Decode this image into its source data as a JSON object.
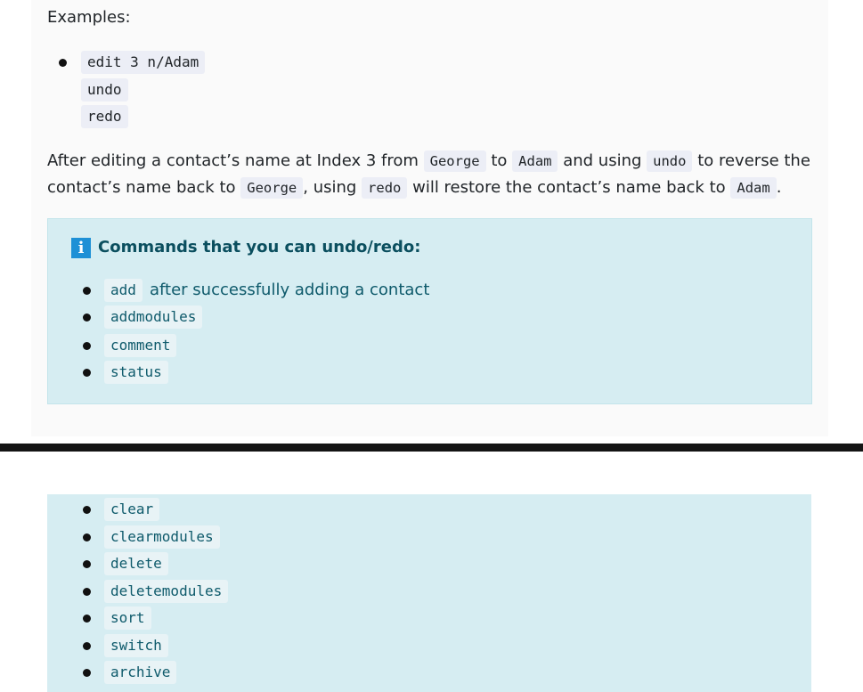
{
  "examples": {
    "title": "Examples:",
    "commands": [
      "edit 3 n/Adam",
      "undo",
      "redo"
    ]
  },
  "explanation": {
    "p1": "After editing a contact’s name at Index 3 from ",
    "c1": "George",
    "p2": " to ",
    "c2": "Adam",
    "p3": " and using ",
    "c3": "undo",
    "p4": " to reverse the contact’s name back to ",
    "c4": "George",
    "p5": ", using ",
    "c5": "redo",
    "p6": " will restore the contact’s name back to ",
    "c6": "Adam",
    "p7": "."
  },
  "info_box": {
    "icon": "info-icon",
    "heading": "Commands that you can undo/redo:",
    "items": [
      {
        "code": "add",
        "text": "after successfully adding a contact"
      },
      {
        "code": "addmodules",
        "text": ""
      },
      {
        "code": "comment",
        "text": ""
      },
      {
        "code": "status",
        "text": ""
      }
    ]
  },
  "info_box_continued": {
    "items": [
      "clear",
      "clearmodules",
      "delete",
      "deletemodules",
      "sort",
      "switch",
      "archive"
    ]
  },
  "colors": {
    "info_background": "#d6edf2",
    "info_text": "#0e5a6b",
    "info_icon": "#1e90d6",
    "code_background": "#eceef6",
    "divider": "#141414"
  }
}
